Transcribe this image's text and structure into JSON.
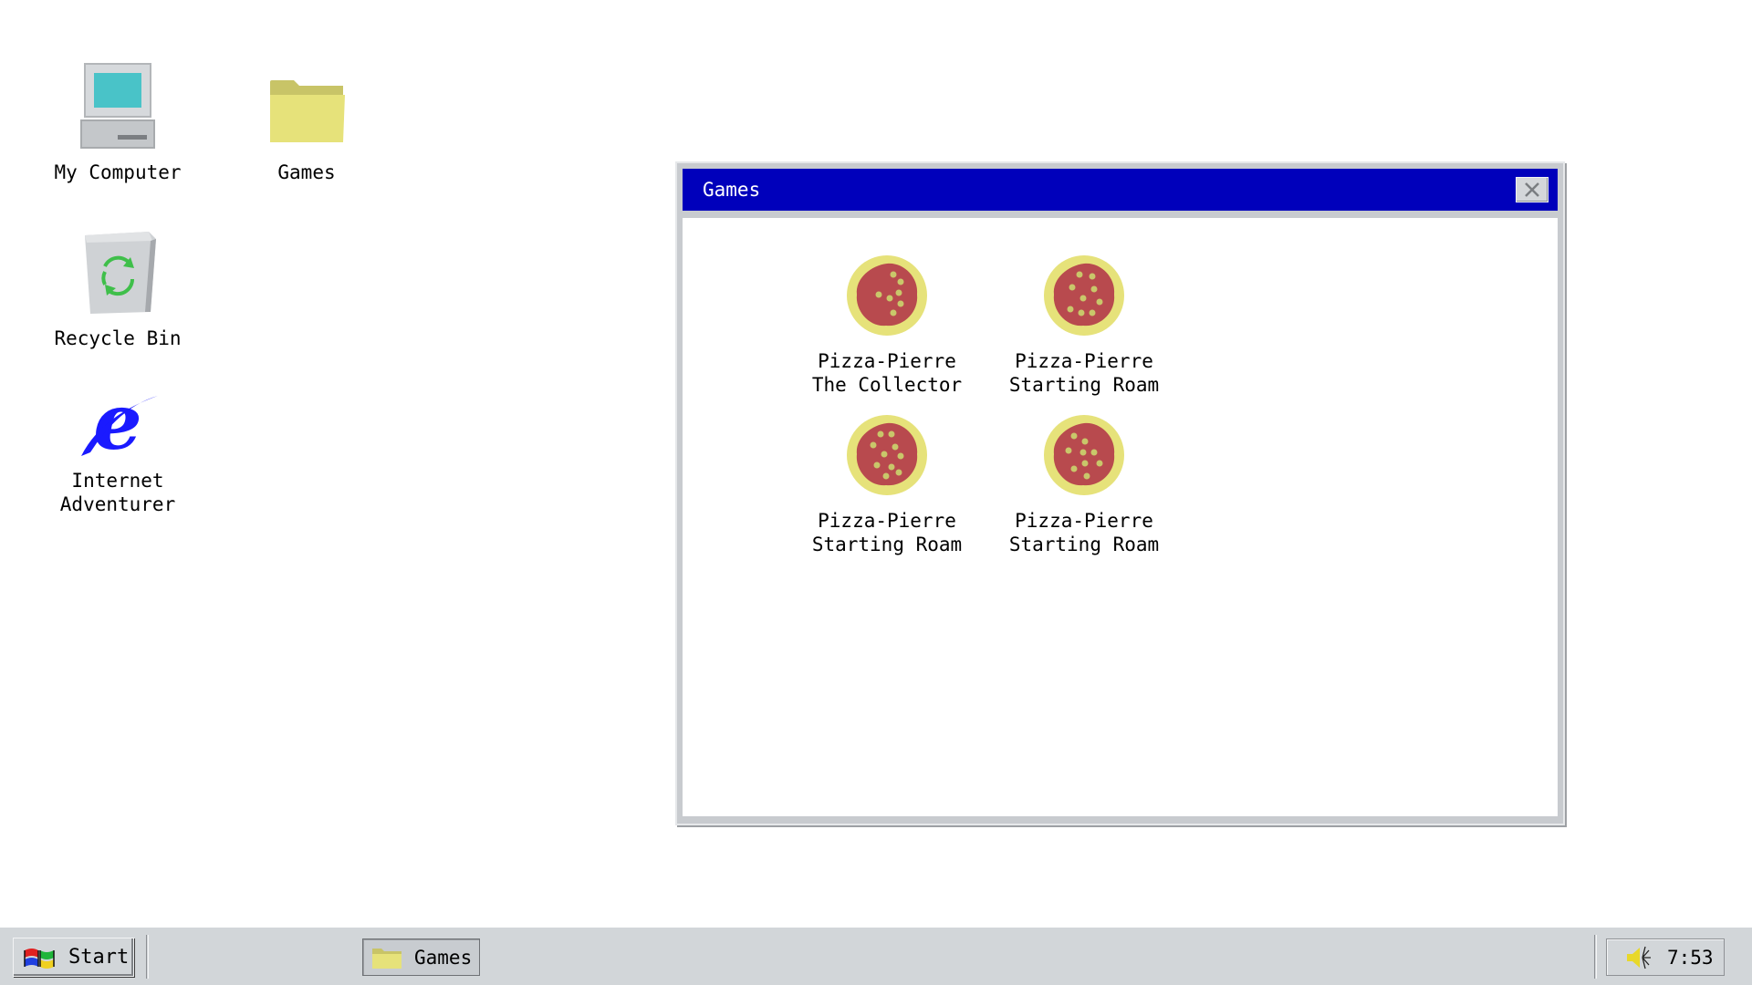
{
  "desktop": {
    "icons": [
      {
        "label": "My Computer",
        "icon": "computer-icon"
      },
      {
        "label": "Games",
        "icon": "folder-icon"
      },
      {
        "label": "Recycle Bin",
        "icon": "recycle-bin-icon"
      },
      {
        "label": "Internet\nAdventurer",
        "icon": "browser-icon"
      }
    ]
  },
  "window": {
    "title": "Games",
    "close_icon": "close-icon",
    "items": [
      {
        "line1": "Pizza-Pierre",
        "line2": "The Collector",
        "icon": "pizza-icon"
      },
      {
        "line1": "Pizza-Pierre",
        "line2": "Starting Roam",
        "icon": "pizza-icon"
      },
      {
        "line1": "Pizza-Pierre",
        "line2": "Starting Roam",
        "icon": "pizza-icon"
      },
      {
        "line1": "Pizza-Pierre",
        "line2": "Starting Roam",
        "icon": "pizza-icon"
      }
    ]
  },
  "taskbar": {
    "start_label": "Start",
    "task_label": "Games",
    "clock": "7:53",
    "tray_icon": "volume-icon"
  },
  "colors": {
    "titlebar": "#0000bb",
    "taskbar": "#d2d6d9",
    "folder": "#e6e27a",
    "pizza_sauce": "#b84a4e",
    "pizza_crust": "#e6e27a"
  }
}
